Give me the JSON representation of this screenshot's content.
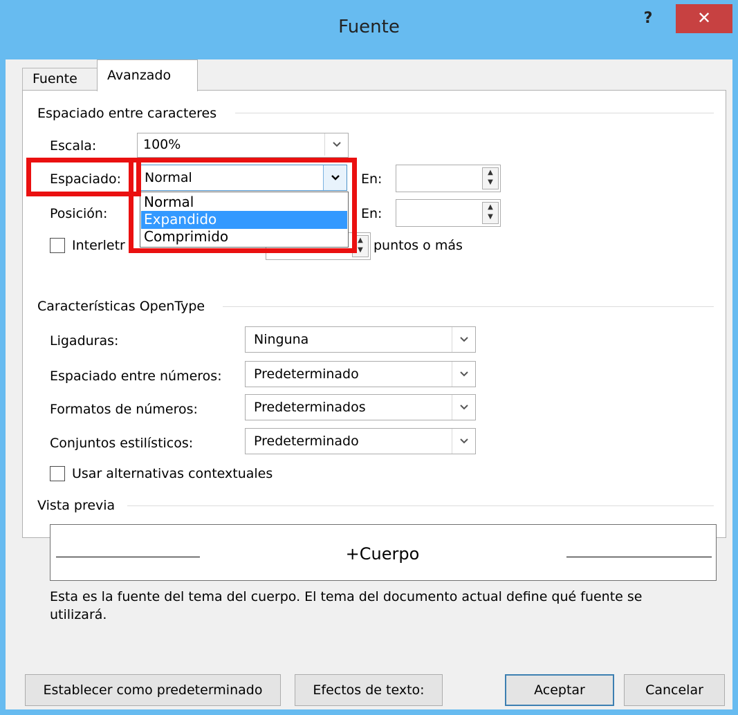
{
  "window": {
    "title": "Fuente",
    "help_label": "?",
    "close_label": "✕"
  },
  "tabs": [
    {
      "label": "Fuente",
      "active": false
    },
    {
      "label": "Avanzado",
      "active": true
    }
  ],
  "spacing_section": {
    "title": "Espaciado entre caracteres",
    "scale_label": "Escala:",
    "scale_value": "100%",
    "spacing_label": "Espaciado:",
    "spacing_value": "Normal",
    "spacing_options": [
      "Normal",
      "Expandido",
      "Comprimido"
    ],
    "spacing_highlighted": "Expandido",
    "position_label": "Posición:",
    "en_label_1": "En:",
    "en_label_2": "En:",
    "kerning_label_visible": "Interletr",
    "kerning_suffix": "puntos o más"
  },
  "opentype_section": {
    "title": "Características OpenType",
    "ligatures_label": "Ligaduras:",
    "ligatures_value": "Ninguna",
    "number_spacing_label": "Espaciado entre números:",
    "number_spacing_value": "Predeterminado",
    "number_forms_label": "Formatos de números:",
    "number_forms_value": "Predeterminados",
    "stylistic_sets_label": "Conjuntos estilísticos:",
    "stylistic_sets_value": "Predeterminado",
    "contextual_alternates_label": "Usar alternativas contextuales"
  },
  "preview_section": {
    "title": "Vista previa",
    "sample_text": "+Cuerpo",
    "description": "Esta es la fuente del tema del cuerpo. El tema del documento actual define qué fuente se",
    "description_2": "utilizará."
  },
  "buttons": {
    "set_default": "Establecer como predeterminado",
    "text_effects": "Efectos de texto:",
    "ok": "Aceptar",
    "cancel": "Cancelar"
  },
  "colors": {
    "titlebar": "#67bbf0",
    "close_button": "#c74141",
    "highlight": "#3399ff",
    "annotation_box": "#ea1010"
  }
}
